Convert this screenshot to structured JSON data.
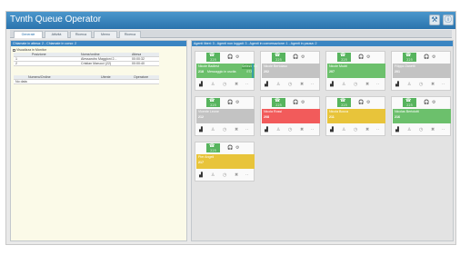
{
  "app": {
    "title": "Tvnth Queue Operator"
  },
  "toolbar": {
    "settings_icon": "wrench-icon",
    "help_icon": "info-icon",
    "settings_glyph": "⚒",
    "help_glyph": "ⓘ"
  },
  "tabs": [
    {
      "label": "Generale"
    },
    {
      "label": "Attività"
    },
    {
      "label": "Ricerca"
    },
    {
      "label": "Memo"
    },
    {
      "label": "Ricerca"
    }
  ],
  "monitor": {
    "header": "Chiamate in attesa: 2 - Chiamate in corso: 2",
    "show_label": "Visualizza in Monitor",
    "columns": [
      "Posizione",
      "Nome/ordine",
      "Attesa"
    ],
    "rows": [
      [
        "1",
        "Alessandro Maggioni 2...",
        "00:00:32"
      ],
      [
        "2",
        "Cristian Marucci (22)",
        "00:00:40"
      ]
    ],
    "columns2": [
      "Numero/Ordine",
      "Utente",
      "Operatore"
    ],
    "rows2": [
      [
        "No data",
        "",
        ""
      ]
    ]
  },
  "agents": {
    "header": "Agenti liberi: 3 - Agenti non loggati: 3 - Agenti in conversazione: 1 - Agenti in pausa: 2",
    "status_colors": {
      "free": "#6cc06c",
      "not-logged": "#c3c3c3",
      "busy": "#f25b5b",
      "pause": "#e8c43a",
      "phone-badge": "#57b45e",
      "accent": "#3aa0a6"
    },
    "icons": {
      "phone": "☎",
      "headset": "🎧",
      "settings": "⚙",
      "desk": "▟",
      "person": "♙",
      "timer": "◷",
      "close": "✖",
      "more": "··"
    },
    "cards": [
      {
        "ext": "225",
        "name": "Nicole Badiest",
        "code": "218",
        "extra": "Messaggio in uscita",
        "tag": "Seleziona",
        "tag2": "ETA",
        "status": "free",
        "accent": true
      },
      {
        "ext": "225",
        "name": "Nicole Bertolaso",
        "code": "202",
        "status": "not-logged"
      },
      {
        "ext": "225",
        "name": "Nicole Mudri",
        "code": "207",
        "status": "free"
      },
      {
        "ext": "225",
        "name": "Filippo Zanetti",
        "code": "201",
        "status": "not-logged"
      },
      {
        "ext": "225",
        "name": "Vicente Leone",
        "code": "212",
        "status": "not-logged"
      },
      {
        "ext": "225",
        "name": "Nicola Rossi",
        "code": "208",
        "status": "busy"
      },
      {
        "ext": "225",
        "name": "Nicola Bocca",
        "code": "211",
        "status": "pause"
      },
      {
        "ext": "225",
        "name": "Nicolas Bertolotti",
        "code": "216",
        "status": "free"
      },
      {
        "ext": "225",
        "name": "Pier Angeli",
        "code": "217",
        "status": "pause"
      }
    ]
  }
}
